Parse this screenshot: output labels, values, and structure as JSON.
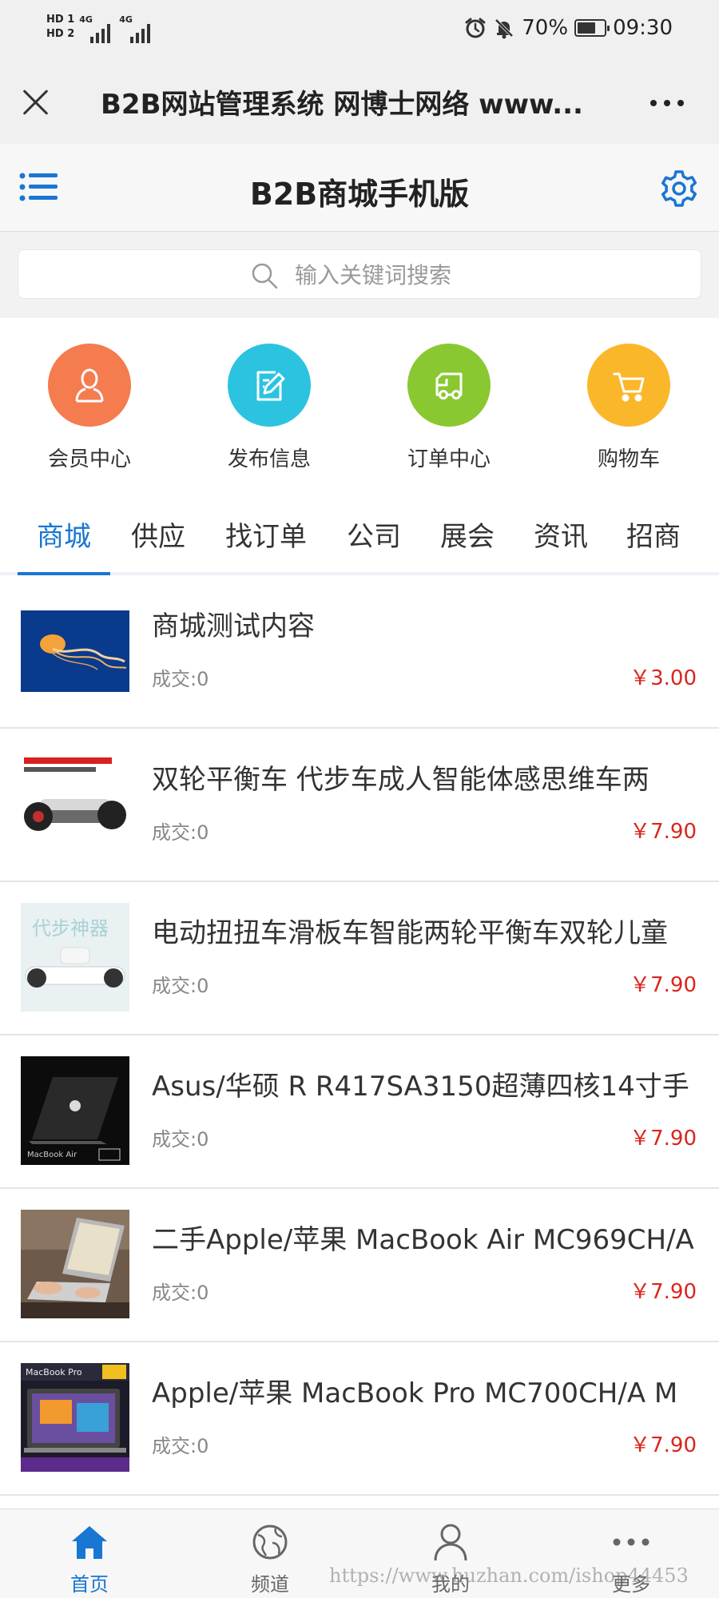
{
  "status_bar": {
    "sim1": "HD 1",
    "sim2": "HD 2",
    "net1": "4G",
    "net2": "4G",
    "battery": "70%",
    "battery_level": 0.7,
    "time": "09:30"
  },
  "browser": {
    "title": "B2B网站管理系统 网博士网络 www..."
  },
  "header": {
    "title": "B2B商城手机版"
  },
  "search": {
    "placeholder": "输入关键词搜索"
  },
  "quick_links": [
    {
      "label": "会员中心",
      "icon": "user-icon",
      "color": "#f47c4f"
    },
    {
      "label": "发布信息",
      "icon": "edit-icon",
      "color": "#2bc3e0"
    },
    {
      "label": "订单中心",
      "icon": "truck-icon",
      "color": "#8ac831"
    },
    {
      "label": "购物车",
      "icon": "cart-icon",
      "color": "#fbb72a"
    }
  ],
  "tabs": [
    "商城",
    "供应",
    "找订单",
    "公司",
    "展会",
    "资讯",
    "招商"
  ],
  "active_tab": 0,
  "products": [
    {
      "name": "商城测试内容",
      "deal": "成交:0",
      "price": "￥3.00",
      "thumb": "jellyfish-photo"
    },
    {
      "name": "双轮平衡车 代步车成人智能体感思维车两",
      "deal": "成交:0",
      "price": "￥7.90",
      "thumb": "hoverboard-photo"
    },
    {
      "name": "电动扭扭车滑板车智能两轮平衡车双轮儿童",
      "deal": "成交:0",
      "price": "￥7.90",
      "thumb": "hoverboard-white-photo",
      "thumb_text": "代步神器"
    },
    {
      "name": "Asus/华硕 R R417SA3150超薄四核14寸手",
      "deal": "成交:0",
      "price": "￥7.90",
      "thumb": "macbook-air-photo",
      "thumb_text": "MacBook Air"
    },
    {
      "name": "二手Apple/苹果 MacBook Air MC969CH/A",
      "deal": "成交:0",
      "price": "￥7.90",
      "thumb": "laptop-hands-photo"
    },
    {
      "name": "Apple/苹果 MacBook Pro MC700CH/A M",
      "deal": "成交:0",
      "price": "￥7.90",
      "thumb": "macbook-pro-photo",
      "thumb_text": "MacBook Pro"
    }
  ],
  "bottom_nav": [
    {
      "label": "首页",
      "icon": "home-icon",
      "active": true
    },
    {
      "label": "频道",
      "icon": "globe-icon",
      "active": false
    },
    {
      "label": "我的",
      "icon": "user-icon",
      "active": false
    },
    {
      "label": "更多",
      "icon": "more-icon",
      "active": false
    }
  ],
  "watermark": "https://www.huzhan.com/ishop44453",
  "colors": {
    "accent": "#1976d2",
    "price": "#d9261c"
  }
}
